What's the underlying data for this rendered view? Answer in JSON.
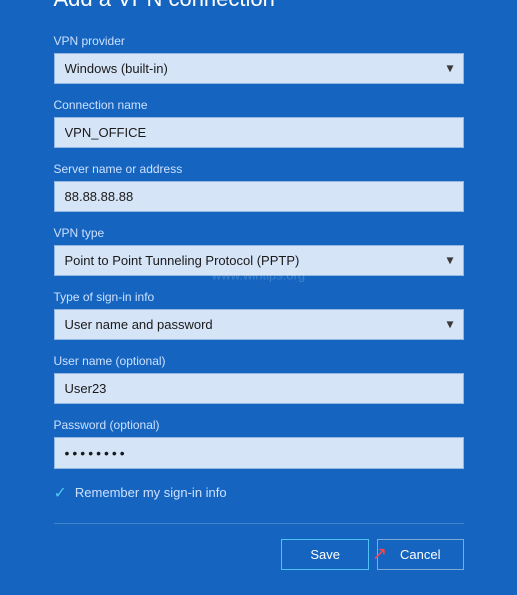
{
  "dialog": {
    "title": "Add a VPN connection",
    "watermark": "www.wintips.org"
  },
  "fields": {
    "vpn_provider": {
      "label": "VPN provider",
      "value": "Windows (built-in)",
      "options": [
        "Windows (built-in)"
      ]
    },
    "connection_name": {
      "label": "Connection name",
      "value": "VPN_OFFICE"
    },
    "server_name": {
      "label": "Server name or address",
      "value": "88.88.88.88"
    },
    "vpn_type": {
      "label": "VPN type",
      "value": "Point to Point Tunneling Protocol (PPTP)",
      "options": [
        "Point to Point Tunneling Protocol (PPTP)"
      ]
    },
    "sign_in_type": {
      "label": "Type of sign-in info",
      "value": "User name and password",
      "options": [
        "User name and password"
      ]
    },
    "user_name": {
      "label": "User name (optional)",
      "value": "User23"
    },
    "password": {
      "label": "Password (optional)",
      "value": "••••••••"
    }
  },
  "remember": {
    "label": "Remember my sign-in info",
    "checked": true,
    "check_symbol": "✓"
  },
  "buttons": {
    "save": "Save",
    "cancel": "Cancel"
  }
}
